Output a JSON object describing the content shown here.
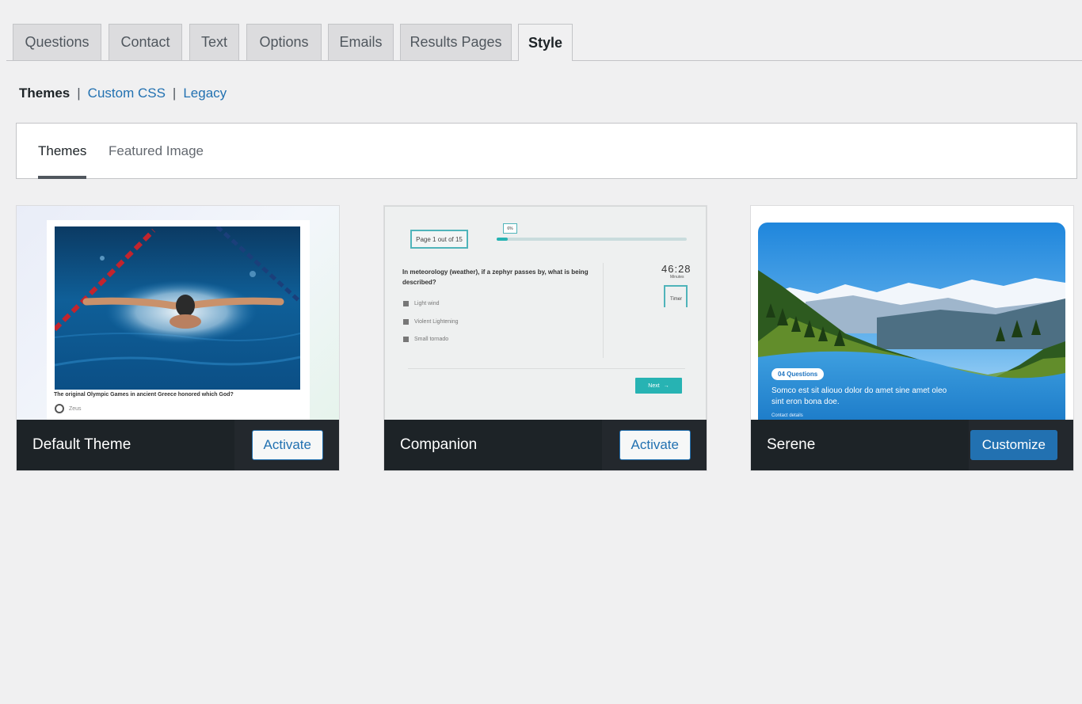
{
  "tabs": [
    {
      "label": "Questions",
      "active": false
    },
    {
      "label": "Contact",
      "active": false
    },
    {
      "label": "Text",
      "active": false
    },
    {
      "label": "Options",
      "active": false
    },
    {
      "label": "Emails",
      "active": false
    },
    {
      "label": "Results Pages",
      "active": false
    },
    {
      "label": "Style",
      "active": true
    }
  ],
  "sublinks": {
    "current": "Themes",
    "separator": "|",
    "custom_css": "Custom CSS",
    "legacy": "Legacy"
  },
  "panel_tabs": {
    "themes": "Themes",
    "featured_image": "Featured Image"
  },
  "themes": [
    {
      "name": "Default Theme",
      "action": "Activate",
      "preview": {
        "question": "The original Olympic Games in ancient Greece honored which God?",
        "option": "Zeus"
      }
    },
    {
      "name": "Companion",
      "action": "Activate",
      "preview": {
        "page_label": "Page 1 out of 15",
        "progress_pct": "6%",
        "progress_value": 0.06,
        "question": "In meteorology (weather), if a zephyr passes by, what is being described?",
        "options": [
          "Light wind",
          "Violent Lightening",
          "Small tornado"
        ],
        "timer": "46:28",
        "timer_unit": "Minutes",
        "timer_label": "Timer",
        "next_label": "Next",
        "next_icon": "arrow-right-icon"
      }
    },
    {
      "name": "Serene",
      "action": "Customize",
      "preview": {
        "badge": "04 Questions",
        "text": "Somco est sit aliouo dolor do amet sine amet oleo sint eron bona doe.",
        "contact": "Contact details"
      }
    }
  ],
  "colors": {
    "link": "#2271b1",
    "primary_button": "#2271b1",
    "card_bar": "#1d2327",
    "accent_teal": "#27b3b3"
  }
}
